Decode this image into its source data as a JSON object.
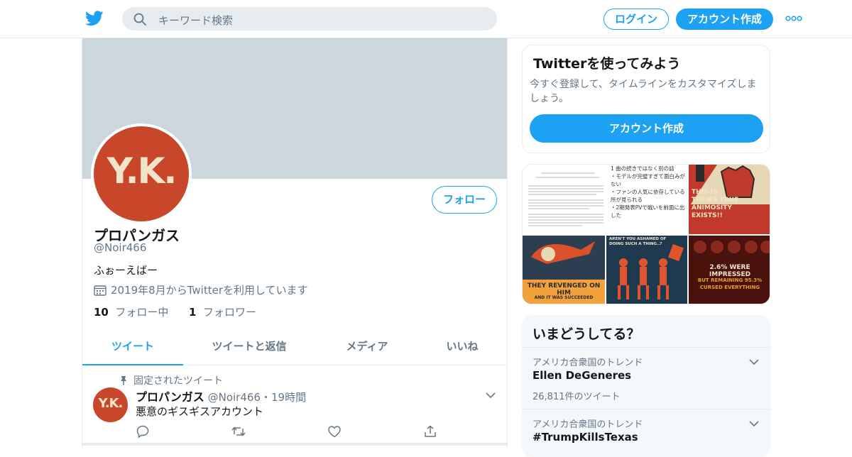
{
  "header": {
    "search_placeholder": "キーワード検索",
    "login_label": "ログイン",
    "signup_label": "アカウント作成",
    "accent": "#1da1f2"
  },
  "profile": {
    "avatar_text": "Y.K.",
    "follow_label": "フォロー",
    "name": "プロパンガス",
    "handle": "@Noir466",
    "bio": "ふぉーえばー",
    "joined": "2019年8月からTwitterを利用しています",
    "following_count": "10",
    "following_label": "フォロー中",
    "followers_count": "1",
    "followers_label": "フォロワー"
  },
  "tabs": [
    {
      "label": "ツイート",
      "active": true
    },
    {
      "label": "ツイートと返信",
      "active": false
    },
    {
      "label": "メディア",
      "active": false
    },
    {
      "label": "いいね",
      "active": false
    }
  ],
  "pinned_tweet": {
    "pinned_label": "固定されたツイート",
    "avatar_text": "Y.K.",
    "name": "プロパンガス",
    "handle": "@Noir466",
    "separator": "・",
    "time": "19時間",
    "text": "悪意のギスギスアカウント"
  },
  "sidebar": {
    "signup_card": {
      "title": "Twitterを使ってみよう",
      "description": "今すぐ登録して、タイムラインをカスタマイズしましょう。",
      "button_label": "アカウント作成"
    },
    "media": [
      {
        "caption": "",
        "lines": [
          "1 曲の続きではなく別の話",
          "・モデルが完璧すぎて面白みがない",
          "・ファンの人気に依存している所が見られる",
          "・2期発表PVで戦いを前面に出した"
        ]
      },
      {
        "caption": "THIS IS THEIRS TRUE ANIMOSITY EXISTS!!"
      },
      {
        "caption": "THEY REVENGED ON HIM",
        "sub": "AND IT WAS SUCCEEDED"
      },
      {
        "caption": "AREN'T YOU ASHAMED OF DOING SUCH A THING..?"
      },
      {
        "caption": "2.6% WERE IMPRESSED",
        "sub": "BUT REMAINING 95.3% CURSED EVERYTHING"
      }
    ],
    "trends": {
      "title": "いまどうしてる？",
      "items": [
        {
          "context": "アメリカ合衆国のトレンド",
          "name": "Ellen DeGeneres",
          "count": "26,811件のツイート"
        },
        {
          "context": "アメリカ合衆国のトレンド",
          "name": "#TrumpKillsTexas",
          "count": ""
        }
      ]
    }
  }
}
